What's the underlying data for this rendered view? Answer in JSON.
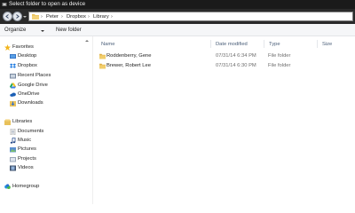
{
  "window": {
    "title": "Select folder to open as device"
  },
  "address": {
    "crumbs": [
      "Peter",
      "Dropbox",
      "Library"
    ]
  },
  "toolbar": {
    "organize_label": "Organize",
    "new_folder_label": "New folder"
  },
  "nav": {
    "favorites": {
      "header": "Favorites",
      "items": [
        {
          "label": "Desktop",
          "icon": "desktop-icon"
        },
        {
          "label": "Dropbox",
          "icon": "dropbox-icon"
        },
        {
          "label": "Recent Places",
          "icon": "recent-places-icon"
        },
        {
          "label": "Google Drive",
          "icon": "google-drive-icon"
        },
        {
          "label": "OneDrive",
          "icon": "onedrive-icon"
        },
        {
          "label": "Downloads",
          "icon": "downloads-icon"
        }
      ]
    },
    "libraries": {
      "header": "Libraries",
      "items": [
        {
          "label": "Documents",
          "icon": "documents-icon"
        },
        {
          "label": "Music",
          "icon": "music-icon"
        },
        {
          "label": "Pictures",
          "icon": "pictures-icon"
        },
        {
          "label": "Projects",
          "icon": "projects-icon"
        },
        {
          "label": "Videos",
          "icon": "videos-icon"
        }
      ]
    },
    "homegroup": {
      "label": "Homegroup"
    }
  },
  "columns": {
    "name": "Name",
    "date_modified": "Date modified",
    "type": "Type",
    "size": "Size"
  },
  "files": [
    {
      "name": "Roddenberry, Gene",
      "date_modified": "07/31/14 6:34 PM",
      "type": "File folder"
    },
    {
      "name": "Brewer, Robert Lee",
      "date_modified": "07/31/14 6:30 PM",
      "type": "File folder"
    }
  ],
  "colors": {
    "titlebar": "#1a1a1a",
    "folder": "#e8c15a",
    "header_text": "#4c607a"
  }
}
